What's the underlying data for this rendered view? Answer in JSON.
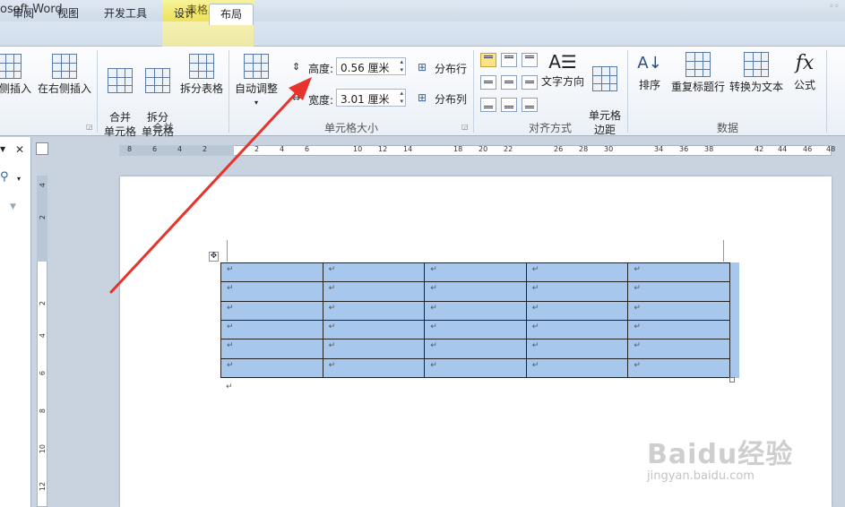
{
  "window": {
    "title_fragment": "osoft Word",
    "context_tab_header": "表格工具"
  },
  "tabs": [
    "审阅",
    "视图",
    "开发工具",
    "设计",
    "布局"
  ],
  "active_tab": "布局",
  "ribbon": {
    "rows_cols": {
      "insert_left": "侧插入",
      "insert_right": "在右侧插入"
    },
    "merge": {
      "merge_cells": "合并\n单元格",
      "split_cells": "拆分\n单元格",
      "split_table": "拆分表格",
      "label": "合并"
    },
    "cell_size": {
      "autofit": "自动调整",
      "height_label": "高度:",
      "height_value": "0.56 厘米",
      "width_label": "宽度:",
      "width_value": "3.01 厘米",
      "distribute_rows": "分布行",
      "distribute_cols": "分布列",
      "label": "单元格大小"
    },
    "alignment": {
      "text_direction": "文字方向",
      "cell_margins": "单元格\n边距",
      "label": "对齐方式"
    },
    "data": {
      "sort": "排序",
      "repeat_header": "重复标题行",
      "convert_text": "转换为文本",
      "formula": "公式",
      "formula_glyph": "fx",
      "label": "数据"
    }
  },
  "ruler": {
    "h_numbers": [
      "8",
      "6",
      "4",
      "2",
      "2",
      "4",
      "6",
      "10",
      "12",
      "14",
      "18",
      "20",
      "22",
      "26",
      "28",
      "30",
      "34",
      "36",
      "38",
      "42",
      "44",
      "46",
      "48"
    ],
    "v_numbers": [
      "4",
      "2",
      "2",
      "4",
      "6",
      "8",
      "10",
      "12"
    ]
  },
  "table": {
    "rows": 6,
    "cols": 5,
    "cell_mark": "↵"
  },
  "watermark": {
    "logo": "Baidu经验",
    "url": "jingyan.baidu.com"
  },
  "colors": {
    "selection": "#a7c8ec",
    "arrow": "#e8322c",
    "context": "#ece25a"
  }
}
